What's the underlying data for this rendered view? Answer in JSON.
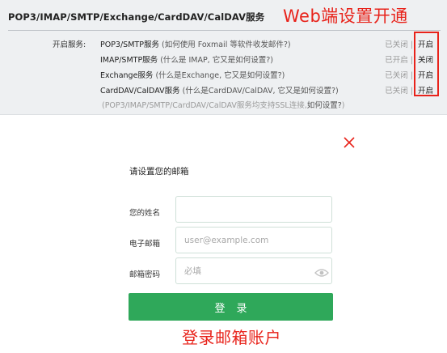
{
  "panel": {
    "title": "POP3/IMAP/SMTP/Exchange/CardDAV/CalDAV服务",
    "banner": "Web端设置开通",
    "services_label": "开启服务:",
    "services": [
      {
        "name": "POP3/SMTP服务",
        "hint": "(如何使用 Foxmail 等软件收发邮件?)",
        "status_options": "已关闭",
        "action": "开启"
      },
      {
        "name": "IMAP/SMTP服务",
        "hint": "(什么是 IMAP, 它又是如何设置?)",
        "status_options": "已开启",
        "action": "关闭"
      },
      {
        "name": "Exchange服务",
        "hint": "(什么是Exchange, 它又是如何设置?)",
        "status_options": "已关闭",
        "action": "开启"
      },
      {
        "name": "CardDAV/CalDAV服务",
        "hint": "(什么是CardDAV/CalDAV, 它又是如何设置?)",
        "status_options": "已关闭",
        "action": "开启"
      }
    ],
    "ssl_note_prefix": "(POP3/IMAP/SMTP/CardDAV/CalDAV服务均支持SSL连接,",
    "ssl_note_link": "如何设置?",
    "ssl_note_suffix": ")"
  },
  "login": {
    "title": "请设置您的邮箱",
    "name_label": "您的姓名",
    "name_value": "",
    "email_label": "电子邮箱",
    "email_placeholder": "user@example.com",
    "password_label": "邮箱密码",
    "password_placeholder": "必填",
    "submit_label": "登录",
    "caption": "登录邮箱账户",
    "close_icon": "close-icon",
    "eye_icon": "eye-icon"
  },
  "colors": {
    "accent_red": "#e8231b",
    "button_green": "#2fa85a",
    "panel_bg": "#eef0f2"
  }
}
